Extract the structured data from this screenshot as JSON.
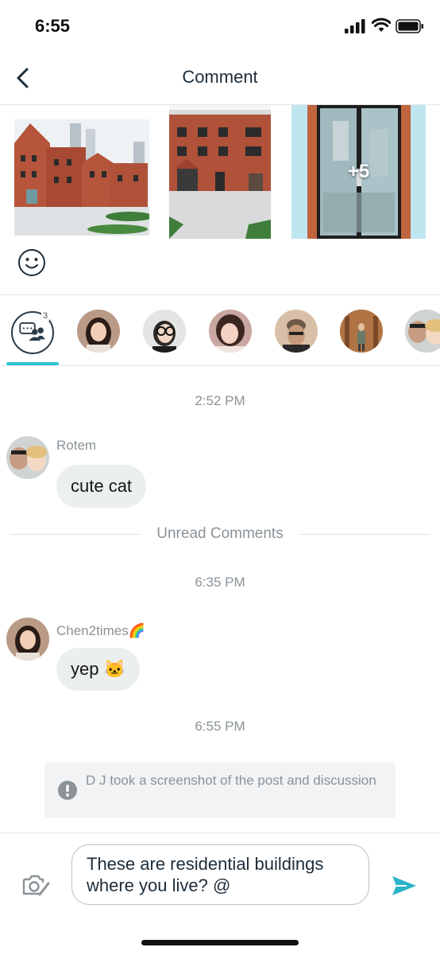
{
  "status_bar": {
    "time": "6:55",
    "icons": [
      "cellular-signal-icon",
      "wifi-icon",
      "battery-icon"
    ]
  },
  "nav": {
    "title": "Comment",
    "back_icon": "chevron-left-icon"
  },
  "photos": {
    "items": [
      "brick building photo",
      "brick building front photo",
      "glass door photo"
    ],
    "more_count_label": "+5"
  },
  "emoji_icon": "smiley-icon",
  "participants": {
    "group_count": "3",
    "group_icon": "group-chat-icon",
    "accent_color": "#34c3d6",
    "avatars": [
      "participant-1",
      "participant-2",
      "participant-3",
      "participant-4",
      "participant-5",
      "participant-6"
    ]
  },
  "chat": {
    "messages_block_1": {
      "time": "2:52 PM",
      "sender": "Rotem",
      "text": "cute cat"
    },
    "unread_label": "Unread Comments",
    "messages_block_2": {
      "time": "6:35 PM",
      "sender": "Chen2times🌈",
      "text": "yep 🐱"
    },
    "messages_block_3": {
      "time": "6:55 PM",
      "system_text": "D J took a screenshot of the post and discussion"
    }
  },
  "composer": {
    "input_value": "These are residential buildings where you live? @",
    "camera_icon": "camera-icon",
    "send_icon": "send-icon",
    "send_color": "#2bb3c8"
  },
  "colors": {
    "bubble": "#eceff0",
    "muted_text": "#8b9398",
    "title": "#1d2d3a"
  }
}
